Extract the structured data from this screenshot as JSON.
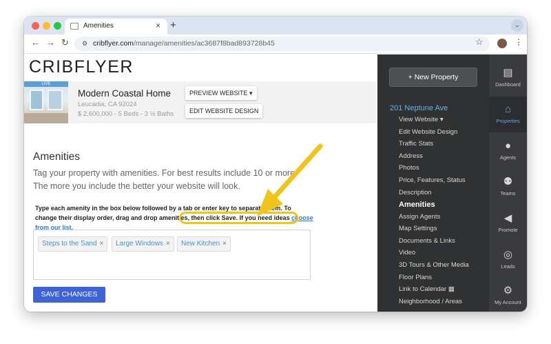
{
  "browser": {
    "tab_title": "Amenities",
    "tab_close": "×",
    "new_tab": "+",
    "tab_menu": "⌄",
    "url_domain": "cribflyer.com",
    "url_path": "/manage/amenities/ac3687f8bad893728b45",
    "back": "←",
    "forward": "→",
    "reload": "↻",
    "star": "☆",
    "menu": "⋮"
  },
  "header": {
    "logo": "CRIBFLYER"
  },
  "property": {
    "badge": "LIVE",
    "name": "Modern Coastal Home",
    "location": "Leucadia, CA 92024",
    "details": "$ 2,600,000 - 5 Beds - 3 ½ Baths",
    "preview_label": "PREVIEW WEBSITE ▾",
    "edit_label": "EDIT WEBSITE DESIGN"
  },
  "main": {
    "title": "Amenities",
    "description": "Tag your property with amenities. For best results include 10 or more. The more you include the better your website will look.",
    "instructions": "Type each amenity in the box below followed by a tab or enter key to separate them. To change their display order, drag and drop amenities, then click Save. If you need ideas",
    "link": "choose from our list.",
    "tags": [
      {
        "label": "Steps to the Sand",
        "remove": "×"
      },
      {
        "label": "Large Windows",
        "remove": "×"
      },
      {
        "label": "New Kitchen",
        "remove": "×"
      }
    ],
    "save_label": "SAVE CHANGES"
  },
  "sidebar": {
    "new_property": "+  New Property",
    "property_heading": "201 Neptune Ave",
    "items": [
      {
        "label": "View Website ▾"
      },
      {
        "label": "Edit Website Design"
      },
      {
        "label": "Traffic Stats"
      },
      {
        "label": "Address"
      },
      {
        "label": "Photos"
      },
      {
        "label": "Price, Features, Status"
      },
      {
        "label": "Description"
      },
      {
        "label": "Amenities"
      },
      {
        "label": "Assign Agents"
      },
      {
        "label": "Map Settings"
      },
      {
        "label": "Documents & Links"
      },
      {
        "label": "Video"
      },
      {
        "label": "3D Tours & Other Media"
      },
      {
        "label": "Floor Plans"
      },
      {
        "label": "Link to Calendar ▦"
      },
      {
        "label": "Neighborhood / Areas"
      }
    ],
    "active_index": 7
  },
  "rail": {
    "items": [
      {
        "label": "Dashboard",
        "icon": "dashboard-icon",
        "glyph": "▤"
      },
      {
        "label": "Properties",
        "icon": "properties-icon",
        "glyph": "⌂"
      },
      {
        "label": "Agents",
        "icon": "agents-icon",
        "glyph": "●"
      },
      {
        "label": "Teams",
        "icon": "teams-icon",
        "glyph": "⚉"
      },
      {
        "label": "Promote",
        "icon": "promote-icon",
        "glyph": "◀"
      },
      {
        "label": "Leads",
        "icon": "leads-icon",
        "glyph": "◎"
      },
      {
        "label": "My Account",
        "icon": "gear-icon",
        "glyph": "⚙"
      }
    ],
    "active_index": 1
  },
  "colors": {
    "accent_blue": "#3d63d6",
    "link_blue": "#2e7bd1",
    "highlight_yellow": "#f0c419",
    "sidebar_bg": "#2f3133",
    "rail_active": "#5fa8e3"
  }
}
